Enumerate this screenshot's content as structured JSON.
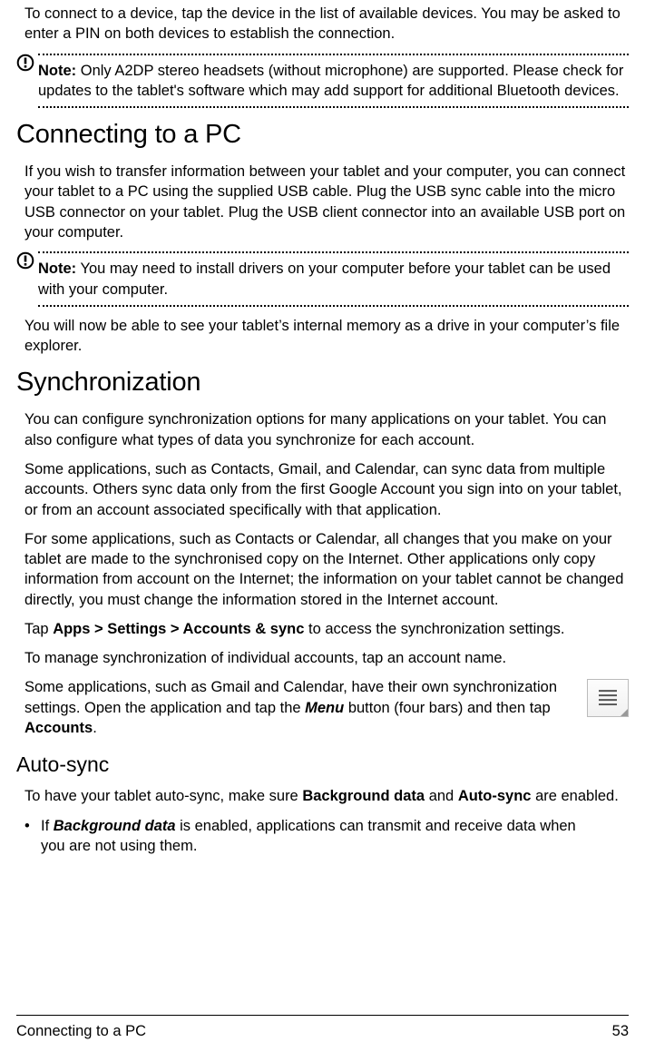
{
  "intro": {
    "p1": "To connect to a device, tap the device in the list of available devices. You may be asked to enter a PIN on both devices to establish the connection."
  },
  "note1": {
    "label": "Note:",
    "text": " Only A2DP stereo headsets (without microphone) are supported. Please check for updates to the tablet's software which may add support for additional Bluetooth devices."
  },
  "h1_pc": "Connecting to a PC",
  "pc": {
    "p1": "If you wish to transfer information between your tablet and your computer, you can connect your tablet to a PC using the supplied USB cable. Plug the USB sync cable into the micro USB connector on your tablet. Plug the USB client connector into an available USB port on your computer."
  },
  "note2": {
    "label": "Note:",
    "text": " You may need to install drivers on your computer before your tablet can be used with your computer."
  },
  "pc_after": "You will now be able to see your tablet’s internal memory as a drive in your computer’s file explorer.",
  "h1_sync": "Synchronization",
  "sync": {
    "p1": "You can configure synchronization options for many applications on your tablet. You can also configure what types of data you synchronize for each account.",
    "p2": "Some applications, such as Contacts, Gmail, and Calendar, can sync data from multiple accounts. Others sync data only from the first Google Account you sign into on your tablet, or from an account associated specifically with that application.",
    "p3": "For some applications, such as Contacts or Calendar, all changes that you make on your tablet are made to the synchronised copy on the Internet. Other applications only copy information from account on the Internet; the information on your tablet cannot be changed directly, you must change the information stored in the Internet account.",
    "p4_a": "Tap ",
    "p4_b": "Apps > Settings > Accounts & sync",
    "p4_c": " to access the synchronization settings.",
    "p5": "To manage synchronization of individual accounts, tap an account name.",
    "p6_a": "Some applications, such as Gmail and Calendar, have their own synchronization settings. Open the application and tap the ",
    "p6_b": "Menu",
    "p6_c": " button (four bars) and then tap ",
    "p6_d": "Accounts",
    "p6_e": "."
  },
  "h2_auto": "Auto-sync",
  "auto": {
    "p1_a": "To have your tablet auto-sync, make sure ",
    "p1_b": "Background data",
    "p1_c": " and ",
    "p1_d": "Auto-sync",
    "p1_e": " are enabled.",
    "bullet_a": "If ",
    "bullet_b": "Background data",
    "bullet_c": " is enabled, applications can transmit and receive data when you are not using them."
  },
  "footer": {
    "left": "Connecting to a PC",
    "right": "53"
  }
}
